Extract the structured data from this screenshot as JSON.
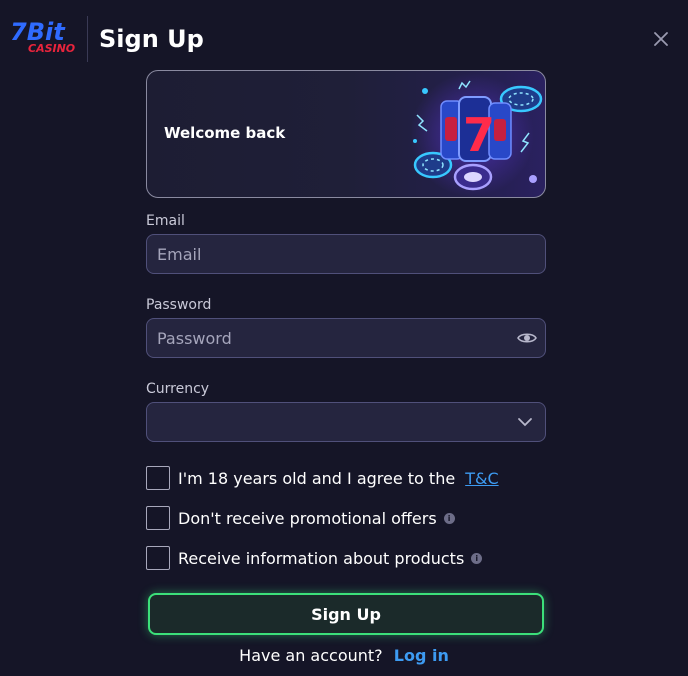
{
  "header": {
    "logo_text_top": "7Bit",
    "logo_text_bottom": "CASINO",
    "title": "Sign Up",
    "close_icon": "close-icon"
  },
  "banner": {
    "text": "Welcome back",
    "art_icon": "slot-machine-chips-illustration"
  },
  "form": {
    "email": {
      "label": "Email",
      "placeholder": "Email",
      "value": ""
    },
    "password": {
      "label": "Password",
      "placeholder": "Password",
      "value": "",
      "icon": "eye-icon"
    },
    "currency": {
      "label": "Currency",
      "value": "",
      "icon": "chevron-down-icon"
    }
  },
  "checkboxes": {
    "age": {
      "label": "I'm 18 years old and I agree to the",
      "link": "T&C",
      "checked": false
    },
    "promo": {
      "label": "Don't receive promotional offers",
      "info_icon": "info-icon",
      "checked": false
    },
    "products": {
      "label": "Receive information about products",
      "info_icon": "info-icon",
      "checked": false
    }
  },
  "signup_button": {
    "label": "Sign Up"
  },
  "footer": {
    "text": "Have an account?",
    "link": "Log in"
  },
  "colors": {
    "background": "#151527",
    "input_bg": "#25253f",
    "accent_green": "#3ce07a",
    "link_blue": "#3d9bf2",
    "logo_red": "#e8243c",
    "logo_blue": "#2f6bff"
  }
}
